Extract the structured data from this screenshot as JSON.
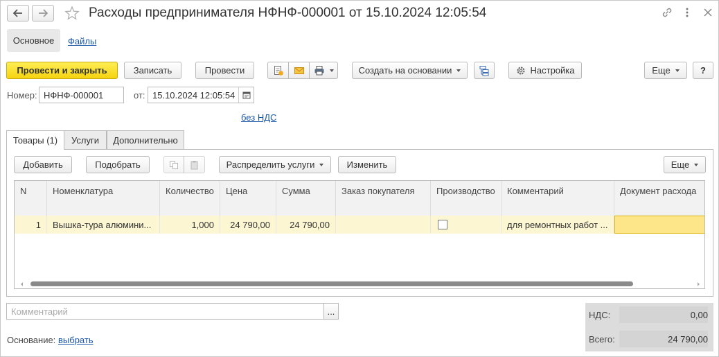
{
  "window": {
    "title": "Расходы предпринимателя НФНФ-000001 от 15.10.2024 12:05:54"
  },
  "icons": {
    "back": "arrow-left-icon",
    "forward": "arrow-right-icon",
    "favorite": "star-icon",
    "link": "link-icon",
    "more": "more-vertical-icon",
    "close": "close-icon"
  },
  "nav": {
    "main": "Основное",
    "files": "Файлы"
  },
  "toolbar": {
    "post_close": "Провести и закрыть",
    "save": "Записать",
    "post": "Провести",
    "create_basis": "Создать на основании",
    "settings": "Настройка",
    "more": "Еще",
    "help": "?"
  },
  "form": {
    "number_label": "Номер:",
    "number_value": "НФНФ-000001",
    "date_label": "от:",
    "date_value": "15.10.2024 12:05:54",
    "vat_link": "без НДС"
  },
  "tabs": [
    {
      "label": "Товары (1)"
    },
    {
      "label": "Услуги"
    },
    {
      "label": "Дополнительно"
    }
  ],
  "table_toolbar": {
    "add": "Добавить",
    "pick": "Подобрать",
    "distribute": "Распределить услуги",
    "change": "Изменить",
    "more": "Еще"
  },
  "table": {
    "columns": [
      "N",
      "Номенклатура",
      "Количество",
      "Цена",
      "Сумма",
      "Заказ покупателя",
      "Производство",
      "Комментарий",
      "Документ расхода"
    ],
    "rows": [
      {
        "n": "1",
        "item": "Вышка-тура алюмини...",
        "qty": "1,000",
        "price": "24 790,00",
        "sum": "24 790,00",
        "order": "",
        "production": false,
        "comment": "для ремонтных работ ...",
        "doc": ""
      }
    ]
  },
  "footer": {
    "comment_placeholder": "Комментарий",
    "ellipsis": "...",
    "basis_label": "Основание:",
    "basis_link": "выбрать"
  },
  "totals": {
    "vat_label": "НДС:",
    "vat_value": "0,00",
    "total_label": "Всего:",
    "total_value": "24 790,00"
  },
  "colors": {
    "primary_button": "#f5d30f",
    "selected_row": "#fcf6d3",
    "active_cell": "#fde68a",
    "link": "#1a56a8"
  }
}
